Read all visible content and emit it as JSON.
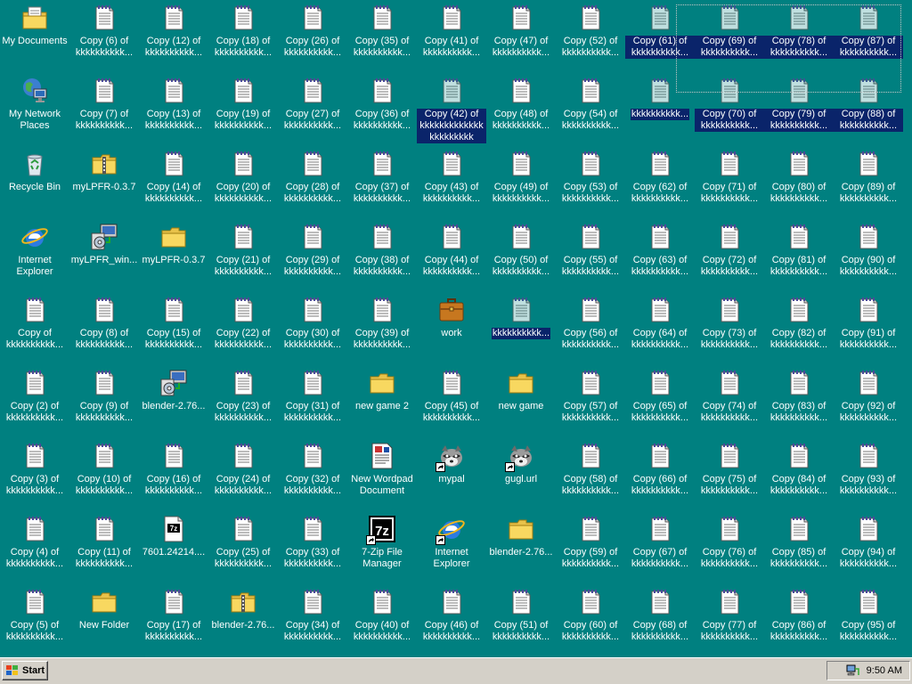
{
  "desktop": {
    "icons": [
      {
        "label": "My Documents",
        "type": "mydocs",
        "col": 0,
        "row": 0
      },
      {
        "label": "My Network Places",
        "type": "network",
        "col": 0,
        "row": 1
      },
      {
        "label": "Recycle Bin",
        "type": "recycle",
        "col": 0,
        "row": 2
      },
      {
        "label": "Internet Explorer",
        "type": "ie",
        "col": 0,
        "row": 3
      },
      {
        "label": "Copy of kkkkkkkkkk...",
        "type": "notepad",
        "col": 0,
        "row": 4
      },
      {
        "label": "Copy (2) of kkkkkkkkkk...",
        "type": "notepad",
        "col": 0,
        "row": 5
      },
      {
        "label": "Copy (3) of kkkkkkkkkk...",
        "type": "notepad",
        "col": 0,
        "row": 6
      },
      {
        "label": "Copy (4) of kkkkkkkkkk...",
        "type": "notepad",
        "col": 0,
        "row": 7
      },
      {
        "label": "Copy (5) of kkkkkkkkkk...",
        "type": "notepad",
        "col": 0,
        "row": 8
      },
      {
        "label": "Copy (6) of kkkkkkkkkk...",
        "type": "notepad",
        "col": 1,
        "row": 0
      },
      {
        "label": "Copy (7) of kkkkkkkkkk...",
        "type": "notepad",
        "col": 1,
        "row": 1
      },
      {
        "label": "myLPFR-0.3.7",
        "type": "zipfolder",
        "col": 1,
        "row": 2
      },
      {
        "label": "myLPFR_win...",
        "type": "installer",
        "col": 1,
        "row": 3
      },
      {
        "label": "Copy (8) of kkkkkkkkkk...",
        "type": "notepad",
        "col": 1,
        "row": 4
      },
      {
        "label": "Copy (9) of kkkkkkkkkk...",
        "type": "notepad",
        "col": 1,
        "row": 5
      },
      {
        "label": "Copy (10) of kkkkkkkkkk...",
        "type": "notepad",
        "col": 1,
        "row": 6
      },
      {
        "label": "Copy (11) of kkkkkkkkkk...",
        "type": "notepad",
        "col": 1,
        "row": 7
      },
      {
        "label": "New Folder",
        "type": "folder",
        "col": 1,
        "row": 8
      },
      {
        "label": "Copy (12) of kkkkkkkkkk...",
        "type": "notepad",
        "col": 2,
        "row": 0
      },
      {
        "label": "Copy (13) of kkkkkkkkkk...",
        "type": "notepad",
        "col": 2,
        "row": 1
      },
      {
        "label": "Copy (14) of kkkkkkkkkk...",
        "type": "notepad",
        "col": 2,
        "row": 2
      },
      {
        "label": "myLPFR-0.3.7",
        "type": "folder",
        "col": 2,
        "row": 3
      },
      {
        "label": "Copy (15) of kkkkkkkkkk...",
        "type": "notepad",
        "col": 2,
        "row": 4
      },
      {
        "label": "blender-2.76...",
        "type": "installer",
        "col": 2,
        "row": 5
      },
      {
        "label": "Copy (16) of kkkkkkkkkk...",
        "type": "notepad",
        "col": 2,
        "row": 6
      },
      {
        "label": "7601.24214....",
        "type": "7zfile",
        "col": 2,
        "row": 7
      },
      {
        "label": "Copy (17) of kkkkkkkkkk...",
        "type": "notepad",
        "col": 2,
        "row": 8
      },
      {
        "label": "Copy (18) of kkkkkkkkkk...",
        "type": "notepad",
        "col": 3,
        "row": 0
      },
      {
        "label": "Copy (19) of kkkkkkkkkk...",
        "type": "notepad",
        "col": 3,
        "row": 1
      },
      {
        "label": "Copy (20) of kkkkkkkkkk...",
        "type": "notepad",
        "col": 3,
        "row": 2
      },
      {
        "label": "Copy (21) of kkkkkkkkkk...",
        "type": "notepad",
        "col": 3,
        "row": 3
      },
      {
        "label": "Copy (22) of kkkkkkkkkk...",
        "type": "notepad",
        "col": 3,
        "row": 4
      },
      {
        "label": "Copy (23) of kkkkkkkkkk...",
        "type": "notepad",
        "col": 3,
        "row": 5
      },
      {
        "label": "Copy (24) of kkkkkkkkkk...",
        "type": "notepad",
        "col": 3,
        "row": 6
      },
      {
        "label": "Copy (25) of kkkkkkkkkk...",
        "type": "notepad",
        "col": 3,
        "row": 7
      },
      {
        "label": "blender-2.76...",
        "type": "zipfolder",
        "col": 3,
        "row": 8
      },
      {
        "label": "Copy (26) of kkkkkkkkkk...",
        "type": "notepad",
        "col": 4,
        "row": 0
      },
      {
        "label": "Copy (27) of kkkkkkkkkk...",
        "type": "notepad",
        "col": 4,
        "row": 1
      },
      {
        "label": "Copy (28) of kkkkkkkkkk...",
        "type": "notepad",
        "col": 4,
        "row": 2
      },
      {
        "label": "Copy (29) of kkkkkkkkkk...",
        "type": "notepad",
        "col": 4,
        "row": 3
      },
      {
        "label": "Copy (30) of kkkkkkkkkk...",
        "type": "notepad",
        "col": 4,
        "row": 4
      },
      {
        "label": "Copy (31) of kkkkkkkkkk...",
        "type": "notepad",
        "col": 4,
        "row": 5
      },
      {
        "label": "Copy (32) of kkkkkkkkkk...",
        "type": "notepad",
        "col": 4,
        "row": 6
      },
      {
        "label": "Copy (33) of kkkkkkkkkk...",
        "type": "notepad",
        "col": 4,
        "row": 7
      },
      {
        "label": "Copy (34) of kkkkkkkkkk...",
        "type": "notepad",
        "col": 4,
        "row": 8
      },
      {
        "label": "Copy (35) of kkkkkkkkkk...",
        "type": "notepad",
        "col": 5,
        "row": 0
      },
      {
        "label": "Copy (36) of kkkkkkkkkk...",
        "type": "notepad",
        "col": 5,
        "row": 1
      },
      {
        "label": "Copy (37) of kkkkkkkkkk...",
        "type": "notepad",
        "col": 5,
        "row": 2
      },
      {
        "label": "Copy (38) of kkkkkkkkkk...",
        "type": "notepad",
        "col": 5,
        "row": 3
      },
      {
        "label": "Copy (39) of kkkkkkkkkk...",
        "type": "notepad",
        "col": 5,
        "row": 4
      },
      {
        "label": "new game 2",
        "type": "folder",
        "col": 5,
        "row": 5
      },
      {
        "label": "New Wordpad Document",
        "type": "wordpad",
        "col": 5,
        "row": 6
      },
      {
        "label": "7-Zip File Manager",
        "type": "7zapp",
        "col": 5,
        "row": 7,
        "shortcut": true
      },
      {
        "label": "Copy (40) of kkkkkkkkkk...",
        "type": "notepad",
        "col": 5,
        "row": 8
      },
      {
        "label": "Copy (41) of kkkkkkkkkk...",
        "type": "notepad",
        "col": 6,
        "row": 0
      },
      {
        "label": "Copy (42) of kkkkkkkkkkkkkkkkkkkkkk",
        "type": "notepad",
        "col": 6,
        "row": 1,
        "selected": true
      },
      {
        "label": "Copy (43) of kkkkkkkkkk...",
        "type": "notepad",
        "col": 6,
        "row": 2
      },
      {
        "label": "Copy (44) of kkkkkkkkkk...",
        "type": "notepad",
        "col": 6,
        "row": 3
      },
      {
        "label": "work",
        "type": "briefcase",
        "col": 6,
        "row": 4
      },
      {
        "label": "Copy (45) of kkkkkkkkkk...",
        "type": "notepad",
        "col": 6,
        "row": 5
      },
      {
        "label": "mypal",
        "type": "raccoon",
        "col": 6,
        "row": 6,
        "shortcut": true
      },
      {
        "label": "Internet Explorer",
        "type": "ie",
        "col": 6,
        "row": 7,
        "shortcut": true
      },
      {
        "label": "Copy (46) of kkkkkkkkkk...",
        "type": "notepad",
        "col": 6,
        "row": 8
      },
      {
        "label": "Copy (47) of kkkkkkkkkk...",
        "type": "notepad",
        "col": 7,
        "row": 0
      },
      {
        "label": "Copy (48) of kkkkkkkkkk...",
        "type": "notepad",
        "col": 7,
        "row": 1
      },
      {
        "label": "Copy (49) of kkkkkkkkkk...",
        "type": "notepad",
        "col": 7,
        "row": 2
      },
      {
        "label": "Copy (50) of kkkkkkkkkk...",
        "type": "notepad",
        "col": 7,
        "row": 3
      },
      {
        "label": "kkkkkkkkkk...",
        "type": "notepad",
        "col": 7,
        "row": 4,
        "selected": true
      },
      {
        "label": "new game",
        "type": "folder",
        "col": 7,
        "row": 5
      },
      {
        "label": "gugl.url",
        "type": "raccoon",
        "col": 7,
        "row": 6,
        "shortcut": true
      },
      {
        "label": "blender-2.76...",
        "type": "folder",
        "col": 7,
        "row": 7
      },
      {
        "label": "Copy (51) of kkkkkkkkkk...",
        "type": "notepad",
        "col": 7,
        "row": 8
      },
      {
        "label": "Copy (52) of kkkkkkkkkk...",
        "type": "notepad",
        "col": 8,
        "row": 0
      },
      {
        "label": "Copy (54) of kkkkkkkkkk...",
        "type": "notepad",
        "col": 8,
        "row": 1
      },
      {
        "label": "Copy (53) of kkkkkkkkkk...",
        "type": "notepad",
        "col": 8,
        "row": 2
      },
      {
        "label": "Copy (55) of kkkkkkkkkk...",
        "type": "notepad",
        "col": 8,
        "row": 3
      },
      {
        "label": "Copy (56) of kkkkkkkkkk...",
        "type": "notepad",
        "col": 8,
        "row": 4
      },
      {
        "label": "Copy (57) of kkkkkkkkkk...",
        "type": "notepad",
        "col": 8,
        "row": 5
      },
      {
        "label": "Copy (58) of kkkkkkkkkk...",
        "type": "notepad",
        "col": 8,
        "row": 6
      },
      {
        "label": "Copy (59) of kkkkkkkkkk...",
        "type": "notepad",
        "col": 8,
        "row": 7
      },
      {
        "label": "Copy (60) of kkkkkkkkkk...",
        "type": "notepad",
        "col": 8,
        "row": 8
      },
      {
        "label": "Copy (61) of kkkkkkkkkk...",
        "type": "notepad",
        "col": 9,
        "row": 0,
        "selected": true
      },
      {
        "label": "kkkkkkkkkk...",
        "type": "notepad",
        "col": 9,
        "row": 1,
        "selected": true
      },
      {
        "label": "Copy (62) of kkkkkkkkkk...",
        "type": "notepad",
        "col": 9,
        "row": 2
      },
      {
        "label": "Copy (63) of kkkkkkkkkk...",
        "type": "notepad",
        "col": 9,
        "row": 3
      },
      {
        "label": "Copy (64) of kkkkkkkkkk...",
        "type": "notepad",
        "col": 9,
        "row": 4
      },
      {
        "label": "Copy (65) of kkkkkkkkkk...",
        "type": "notepad",
        "col": 9,
        "row": 5
      },
      {
        "label": "Copy (66) of kkkkkkkkkk...",
        "type": "notepad",
        "col": 9,
        "row": 6
      },
      {
        "label": "Copy (67) of kkkkkkkkkk...",
        "type": "notepad",
        "col": 9,
        "row": 7
      },
      {
        "label": "Copy (68) of kkkkkkkkkk...",
        "type": "notepad",
        "col": 9,
        "row": 8
      },
      {
        "label": "Copy (69) of kkkkkkkkkk...",
        "type": "notepad",
        "col": 10,
        "row": 0,
        "selected": true
      },
      {
        "label": "Copy (70) of kkkkkkkkkk...",
        "type": "notepad",
        "col": 10,
        "row": 1,
        "selected": true
      },
      {
        "label": "Copy (71) of kkkkkkkkkk...",
        "type": "notepad",
        "col": 10,
        "row": 2
      },
      {
        "label": "Copy (72) of kkkkkkkkkk...",
        "type": "notepad",
        "col": 10,
        "row": 3
      },
      {
        "label": "Copy (73) of kkkkkkkkkk...",
        "type": "notepad",
        "col": 10,
        "row": 4
      },
      {
        "label": "Copy (74) of kkkkkkkkkk...",
        "type": "notepad",
        "col": 10,
        "row": 5
      },
      {
        "label": "Copy (75) of kkkkkkkkkk...",
        "type": "notepad",
        "col": 10,
        "row": 6
      },
      {
        "label": "Copy (76) of kkkkkkkkkk...",
        "type": "notepad",
        "col": 10,
        "row": 7
      },
      {
        "label": "Copy (77) of kkkkkkkkkk...",
        "type": "notepad",
        "col": 10,
        "row": 8
      },
      {
        "label": "Copy (78) of kkkkkkkkkk...",
        "type": "notepad",
        "col": 11,
        "row": 0,
        "selected": true
      },
      {
        "label": "Copy (79) of kkkkkkkkkk...",
        "type": "notepad",
        "col": 11,
        "row": 1,
        "selected": true
      },
      {
        "label": "Copy (80) of kkkkkkkkkk...",
        "type": "notepad",
        "col": 11,
        "row": 2
      },
      {
        "label": "Copy (81) of kkkkkkkkkk...",
        "type": "notepad",
        "col": 11,
        "row": 3
      },
      {
        "label": "Copy (82) of kkkkkkkkkk...",
        "type": "notepad",
        "col": 11,
        "row": 4
      },
      {
        "label": "Copy (83) of kkkkkkkkkk...",
        "type": "notepad",
        "col": 11,
        "row": 5
      },
      {
        "label": "Copy (84) of kkkkkkkkkk...",
        "type": "notepad",
        "col": 11,
        "row": 6
      },
      {
        "label": "Copy (85) of kkkkkkkkkk...",
        "type": "notepad",
        "col": 11,
        "row": 7
      },
      {
        "label": "Copy (86) of kkkkkkkkkk...",
        "type": "notepad",
        "col": 11,
        "row": 8
      },
      {
        "label": "Copy (87) of kkkkkkkkkk...",
        "type": "notepad",
        "col": 12,
        "row": 0,
        "selected": true
      },
      {
        "label": "Copy (88) of kkkkkkkkkk...",
        "type": "notepad",
        "col": 12,
        "row": 1,
        "selected": true
      },
      {
        "label": "Copy (89) of kkkkkkkkkk...",
        "type": "notepad",
        "col": 12,
        "row": 2
      },
      {
        "label": "Copy (90) of kkkkkkkkkk...",
        "type": "notepad",
        "col": 12,
        "row": 3
      },
      {
        "label": "Copy (91) of kkkkkkkkkk...",
        "type": "notepad",
        "col": 12,
        "row": 4
      },
      {
        "label": "Copy (92) of kkkkkkkkkk...",
        "type": "notepad",
        "col": 12,
        "row": 5
      },
      {
        "label": "Copy (93) of kkkkkkkkkk...",
        "type": "notepad",
        "col": 12,
        "row": 6
      },
      {
        "label": "Copy (94) of kkkkkkkkkk...",
        "type": "notepad",
        "col": 12,
        "row": 7
      },
      {
        "label": "Copy (95) of kkkkkkkkkk...",
        "type": "notepad",
        "col": 12,
        "row": 8
      }
    ]
  },
  "taskbar": {
    "start_label": "Start",
    "clock": "9:50 AM",
    "tray_icons": [
      "keyboard-icon",
      "network-tray-icon"
    ]
  },
  "colors": {
    "desktop_bg": "#008080",
    "selection": "#0a246a",
    "taskbar_bg": "#d4d0c8"
  }
}
